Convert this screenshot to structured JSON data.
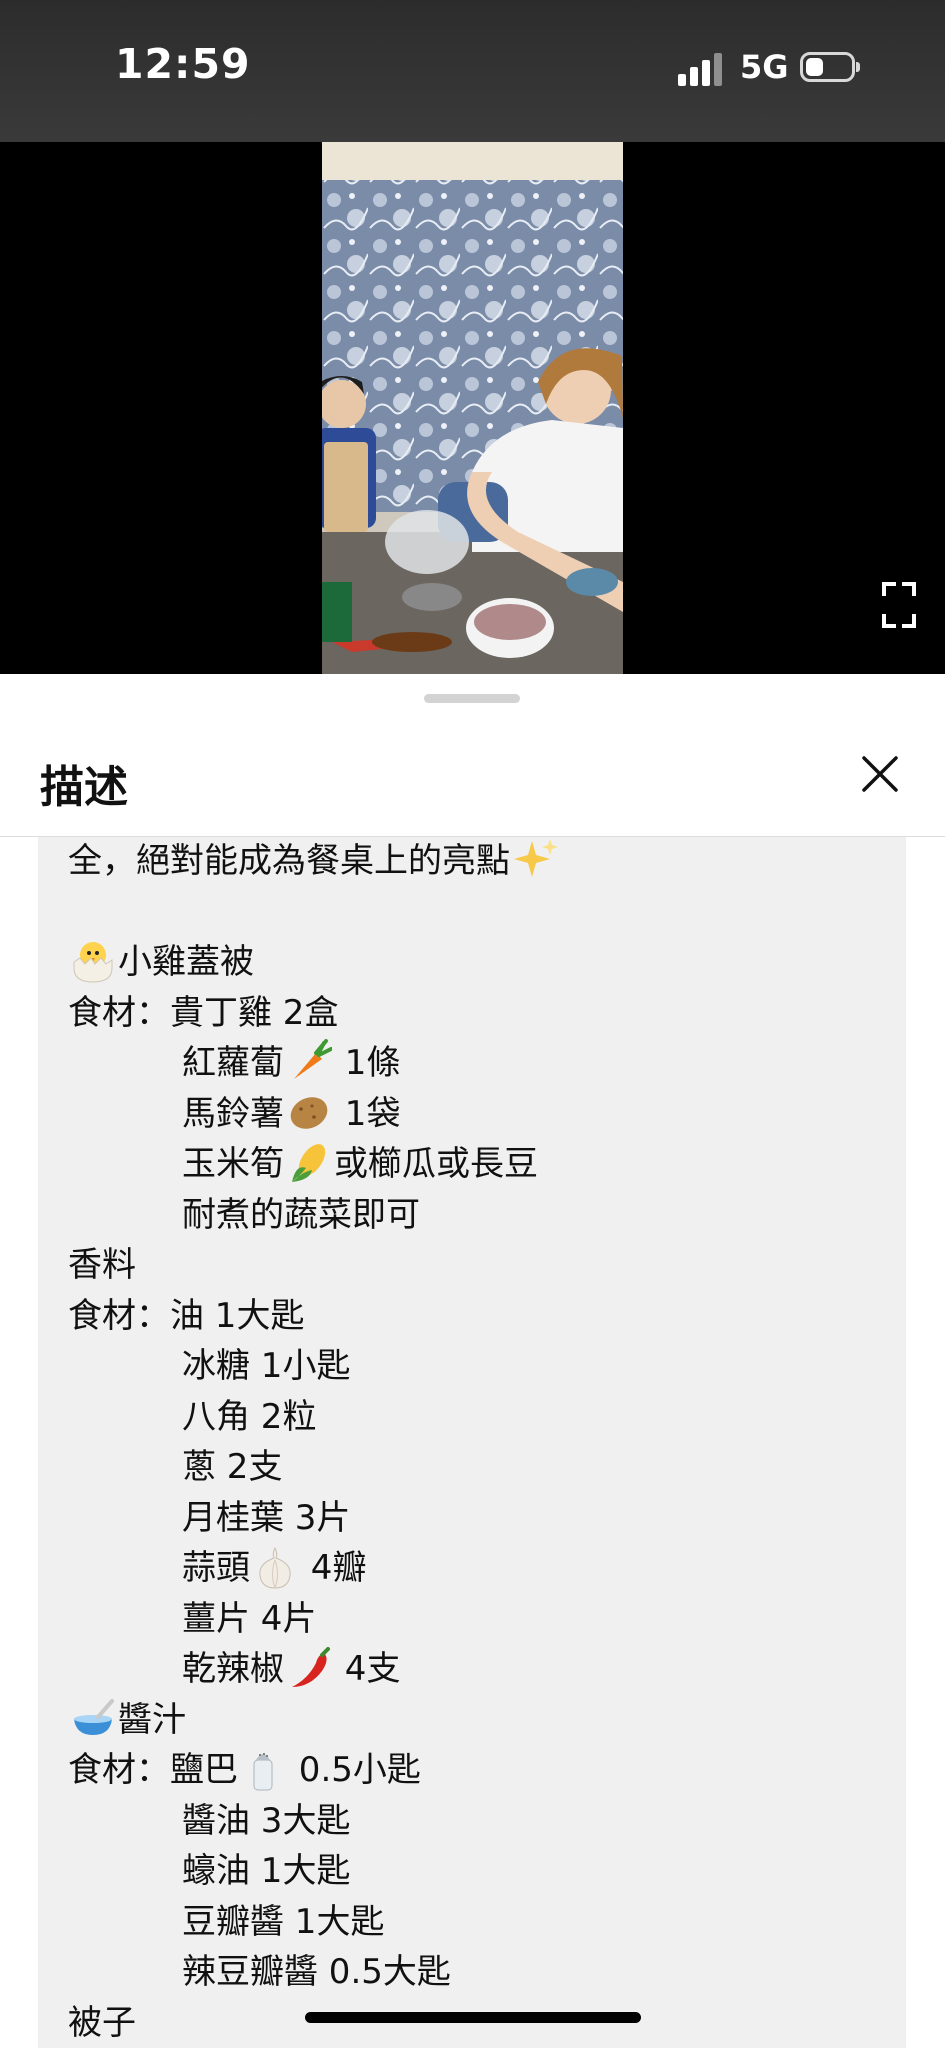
{
  "status_bar": {
    "time": "12:59",
    "network": "5G"
  },
  "sheet": {
    "title": "描述",
    "lines": [
      {
        "indent": false,
        "icon": "",
        "text": "全，絕對能成為餐桌上的亮點",
        "trail_icon": "sparkles-icon"
      },
      {
        "indent": false,
        "icon": "",
        "text": ""
      },
      {
        "indent": false,
        "icon": "hatching-chick-icon",
        "text": "小雞蓋被"
      },
      {
        "indent": false,
        "icon": "",
        "text": "食材：貴丁雞 2盒"
      },
      {
        "indent": true,
        "icon": "",
        "text": "紅蘿蔔",
        "mid_icon": "carrot-icon",
        "after": " 1條"
      },
      {
        "indent": true,
        "icon": "",
        "text": "馬鈴薯",
        "mid_icon": "potato-icon",
        "after": " 1袋"
      },
      {
        "indent": true,
        "icon": "",
        "text": "玉米筍",
        "mid_icon": "corn-icon",
        "after": "或櫛瓜或長豆"
      },
      {
        "indent": true,
        "icon": "",
        "text": "耐煮的蔬菜即可"
      },
      {
        "indent": false,
        "icon": "",
        "text": "香料"
      },
      {
        "indent": false,
        "icon": "",
        "text": "食材：油 1大匙"
      },
      {
        "indent": true,
        "icon": "",
        "text": "冰糖 1小匙"
      },
      {
        "indent": true,
        "icon": "",
        "text": "八角 2粒"
      },
      {
        "indent": true,
        "icon": "",
        "text": "蔥 2支"
      },
      {
        "indent": true,
        "icon": "",
        "text": "月桂葉 3片"
      },
      {
        "indent": true,
        "icon": "",
        "text": "蒜頭",
        "mid_icon": "garlic-icon",
        "after": " 4瓣"
      },
      {
        "indent": true,
        "icon": "",
        "text": "薑片 4片"
      },
      {
        "indent": true,
        "icon": "",
        "text": "乾辣椒",
        "mid_icon": "chili-pepper-icon",
        "after": " 4支"
      },
      {
        "indent": false,
        "icon": "bowl-with-spoon-icon",
        "text": "醬汁"
      },
      {
        "indent": false,
        "icon": "",
        "text": "食材：鹽巴",
        "mid_icon": "salt-shaker-icon",
        "after": " 0.5小匙"
      },
      {
        "indent": true,
        "icon": "",
        "text": "醬油 3大匙"
      },
      {
        "indent": true,
        "icon": "",
        "text": "蠔油 1大匙"
      },
      {
        "indent": true,
        "icon": "",
        "text": "豆瓣醬 1大匙"
      },
      {
        "indent": true,
        "icon": "",
        "text": "辣豆瓣醬 0.5大匙"
      },
      {
        "indent": false,
        "icon": "",
        "text": "被子"
      }
    ]
  }
}
